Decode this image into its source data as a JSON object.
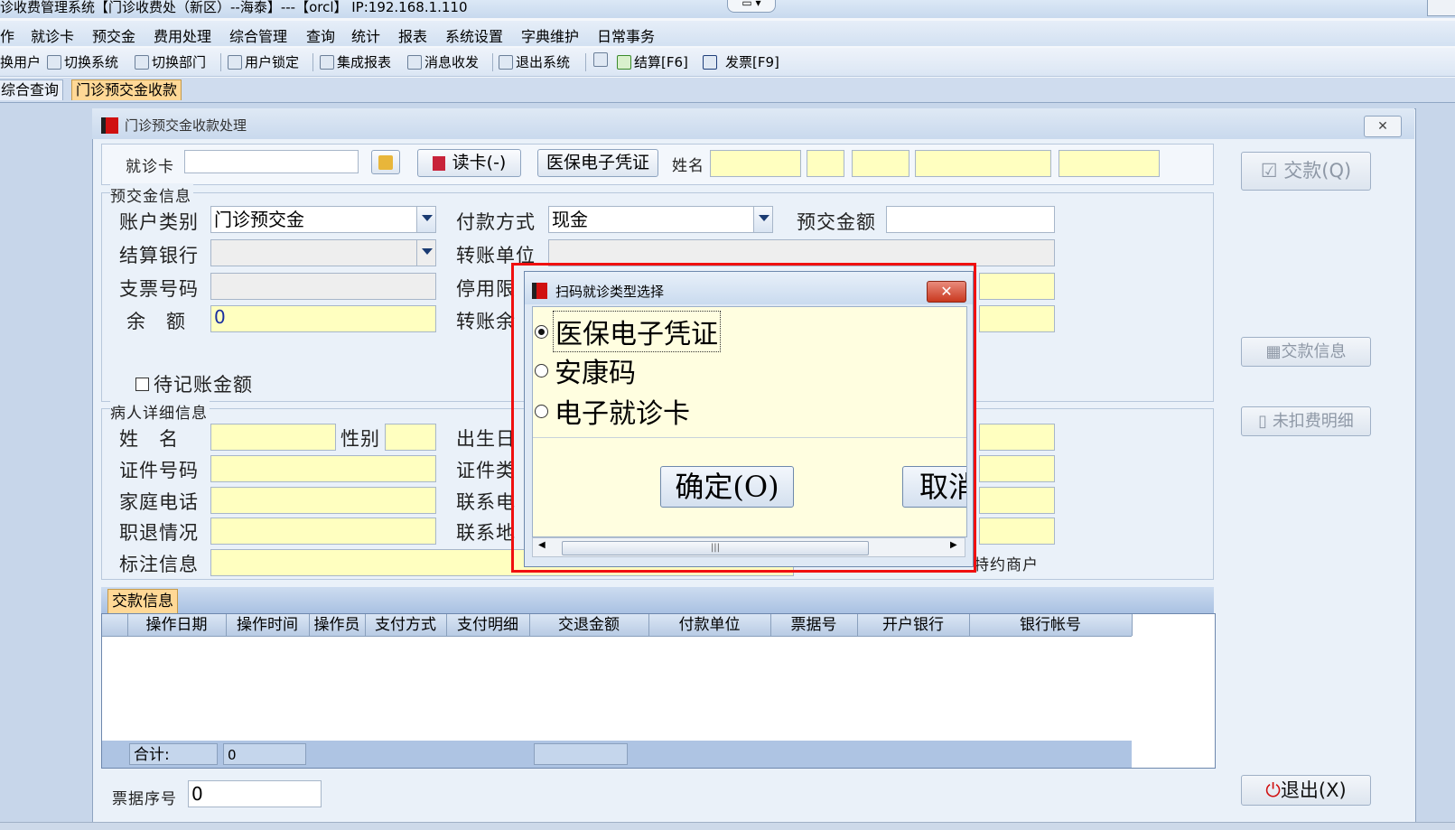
{
  "window": {
    "title": "诊收费管理系统【门诊收费处（新区）--海泰】---【orcl】 IP:192.168.1.110"
  },
  "menu": [
    "作",
    "就诊卡",
    "预交金",
    "费用处理",
    "综合管理",
    "查询",
    "统计",
    "报表",
    "系统设置",
    "字典维护",
    "日常事务"
  ],
  "toolbar": {
    "items": [
      "换用户",
      "切换系统",
      "切换部门",
      "用户锁定",
      "集成报表",
      "消息收发",
      "退出系统",
      "结算[F6]",
      "发票[F9]"
    ]
  },
  "doc_tabs": [
    "综合查询",
    "门诊预交金收款"
  ],
  "child_window": {
    "title": "门诊预交金收款处理"
  },
  "form": {
    "card_label": "就诊卡",
    "card_value": "",
    "read_card_button": "读卡(-)",
    "insurance_button": "医保电子凭证",
    "name_label": "姓名",
    "prepay_section": "预交金信息",
    "account_type_label": "账户类别",
    "account_type_value": "门诊预交金",
    "pay_method_label": "付款方式",
    "pay_method_value": "现金",
    "prepay_amount_label": "预交金额",
    "prepay_amount_value": "",
    "settle_bank_label": "结算银行",
    "transfer_unit_label": "转账单位",
    "check_no_label": "支票号码",
    "stop_limit_label": "停用限",
    "balance_label": "余　额",
    "balance_value": "0",
    "transfer_balance_label": "转账余",
    "pending_label": "待记账金额",
    "patient_section": "病人详细信息",
    "p_name_label": "姓　名",
    "p_gender_label": "性别",
    "p_birth_label": "出生日",
    "p_id_label": "证件号码",
    "p_idtype_label": "证件类",
    "p_phone_label": "家庭电话",
    "p_contact_label": "联系电",
    "p_retire_label": "职退情况",
    "p_address_label": "联系地",
    "p_note_label": "标注信息",
    "special_merchant": "特约商户"
  },
  "payment_tab": "交款信息",
  "grid": {
    "columns": [
      "操作日期",
      "操作时间",
      "操作员",
      "支付方式",
      "支付明细",
      "交退金额",
      "付款单位",
      "票据号",
      "开户银行",
      "银行帐号"
    ],
    "total_label": "合计:",
    "total_value": "0"
  },
  "receipt_label": "票据序号",
  "receipt_value": "0",
  "right_buttons": {
    "pay": "交款(Q)",
    "pay_info": "交款信息",
    "unpaid_detail": "未扣费明细",
    "exit": "退出(X)"
  },
  "modal": {
    "title": "扫码就诊类型选择",
    "options": [
      "医保电子凭证",
      "安康码",
      "电子就诊卡"
    ],
    "selected": 0,
    "ok_button": "确定(O)",
    "cancel_button": "取消"
  }
}
